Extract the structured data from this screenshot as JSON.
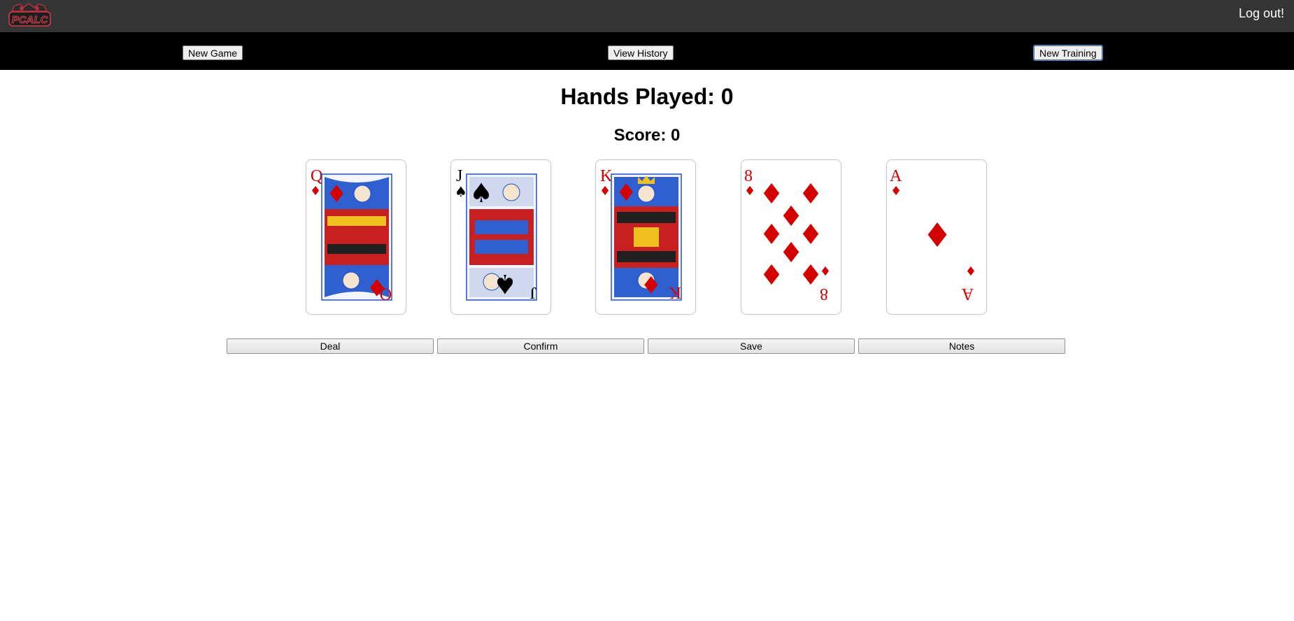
{
  "header": {
    "logo_text": "PCALC",
    "logout_label": "Log out!"
  },
  "nav": {
    "new_game_label": "New Game",
    "view_history_label": "View History",
    "new_training_label": "New Training"
  },
  "stats": {
    "hands_played": "Hands Played: 0",
    "score": "Score: 0"
  },
  "cards": [
    {
      "rank": "Q",
      "suit": "diamonds",
      "suit_symbol": "♦",
      "color": "#d40000"
    },
    {
      "rank": "J",
      "suit": "spades",
      "suit_symbol": "♠",
      "color": "#000000"
    },
    {
      "rank": "K",
      "suit": "diamonds",
      "suit_symbol": "♦",
      "color": "#d40000"
    },
    {
      "rank": "8",
      "suit": "diamonds",
      "suit_symbol": "♦",
      "color": "#d40000"
    },
    {
      "rank": "A",
      "suit": "diamonds",
      "suit_symbol": "♦",
      "color": "#d40000"
    }
  ],
  "actions": {
    "deal_label": "Deal",
    "confirm_label": "Confirm",
    "save_label": "Save",
    "notes_label": "Notes"
  }
}
